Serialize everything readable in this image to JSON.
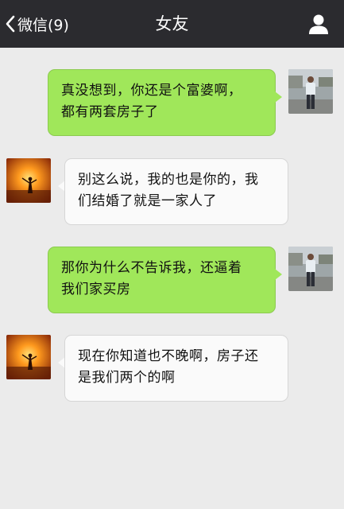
{
  "header": {
    "back_label": "微信(9)",
    "title": "女友",
    "profile_icon": "person-icon"
  },
  "colors": {
    "nav_bg": "#2b2b2f",
    "outgoing_bubble": "#a0e75a",
    "incoming_bubble": "#fafafa",
    "chat_bg": "#ebebeb"
  },
  "messages": [
    {
      "from": "me",
      "lines": [
        "真没想到，你还是个富婆啊，",
        "都有两套房子了"
      ]
    },
    {
      "from": "girlfriend",
      "lines": [
        "别这么说，我的也是你的，我",
        "们结婚了就是一家人了"
      ]
    },
    {
      "from": "me",
      "lines": [
        "那你为什么不告诉我，还逼着",
        "我们家买房"
      ]
    },
    {
      "from": "girlfriend",
      "lines": [
        "现在你知道也不晚啊，房子还",
        "是我们两个的啊"
      ]
    }
  ]
}
